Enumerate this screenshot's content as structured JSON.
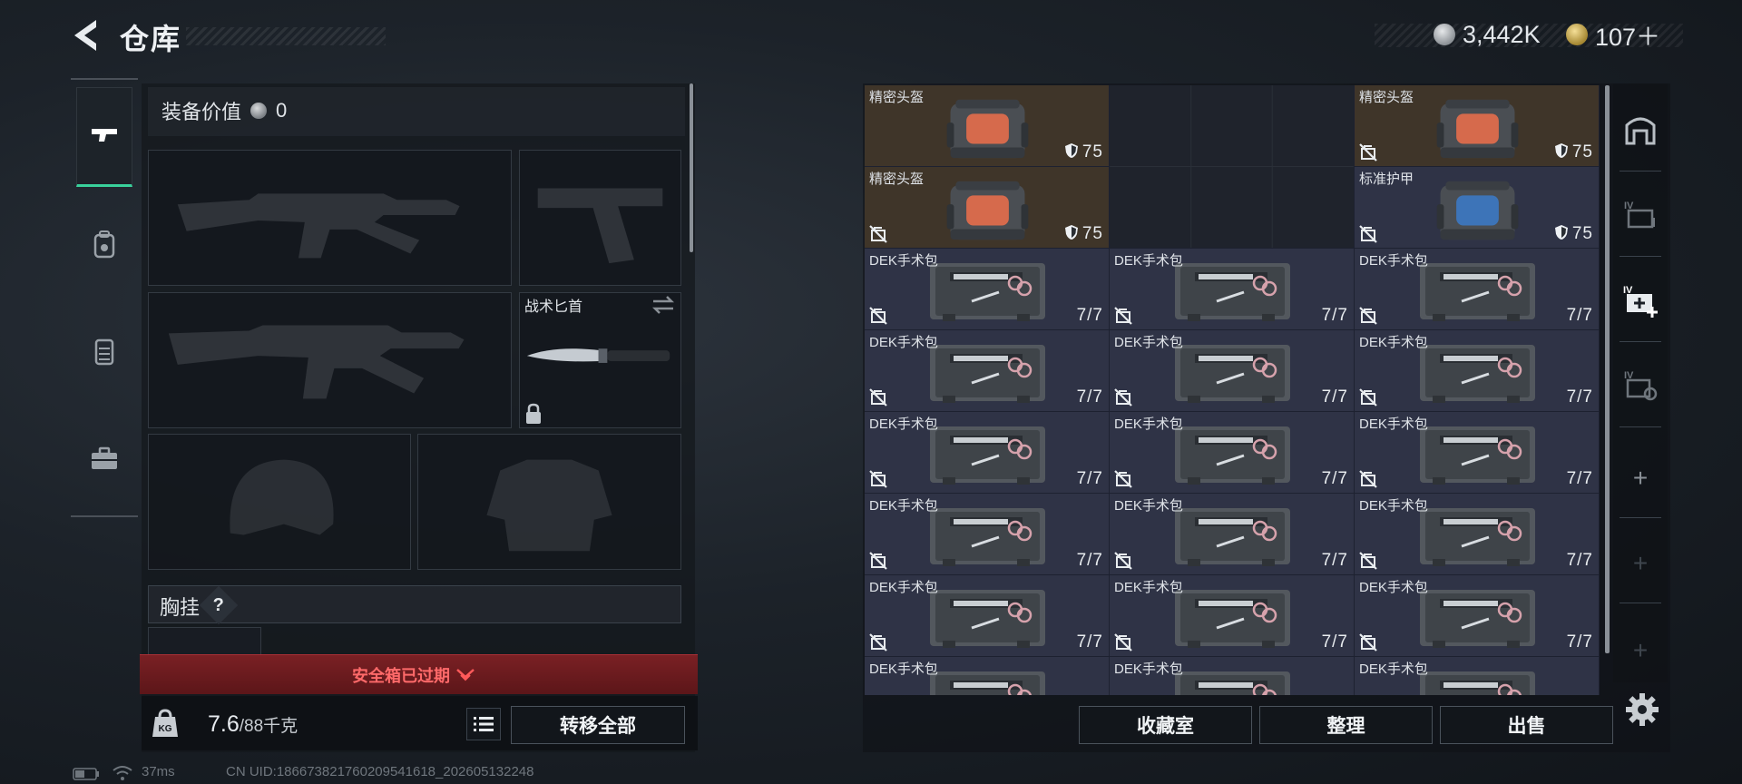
{
  "header": {
    "title": "仓库",
    "currency_silver": "3,442K",
    "currency_gold": "107＋"
  },
  "left_tabs": [
    {
      "icon": "pistol-icon",
      "active": true
    },
    {
      "icon": "backpack-icon",
      "active": false
    },
    {
      "icon": "vest-icon",
      "active": false
    },
    {
      "icon": "toolbox-icon",
      "active": false
    }
  ],
  "equipment": {
    "label": "装备价值",
    "value": "0",
    "knife_name": "战术匕首",
    "chest_label": "胸挂",
    "help": "?",
    "expired_text": "安全箱已过期",
    "weight_current": "7.6",
    "weight_max": "/88千克",
    "transfer_all": "转移全部"
  },
  "storage": {
    "items": [
      {
        "name": "精密头盔",
        "stat": "75",
        "kind": "bag-orange",
        "tone": "gold",
        "nosell": false
      },
      {
        "name": "",
        "kind": "empty"
      },
      {
        "name": "精密头盔",
        "stat": "75",
        "kind": "bag-orange",
        "tone": "gold",
        "nosell": true
      },
      {
        "name": "精密头盔",
        "stat": "75",
        "kind": "bag-orange",
        "tone": "gold",
        "nosell": true
      },
      {
        "name": "标准护甲",
        "stat": "75",
        "kind": "bag-blue",
        "tone": "purple",
        "nosell": true
      }
    ],
    "medkit_name": "DEK手术包",
    "medkit_count": "7/7",
    "buttons": {
      "collection": "收藏室",
      "organize": "整理",
      "sell": "出售"
    }
  },
  "status_bar": {
    "ping": "37ms",
    "uid": "CN UID:18667382176020954161​8_202605132248"
  }
}
